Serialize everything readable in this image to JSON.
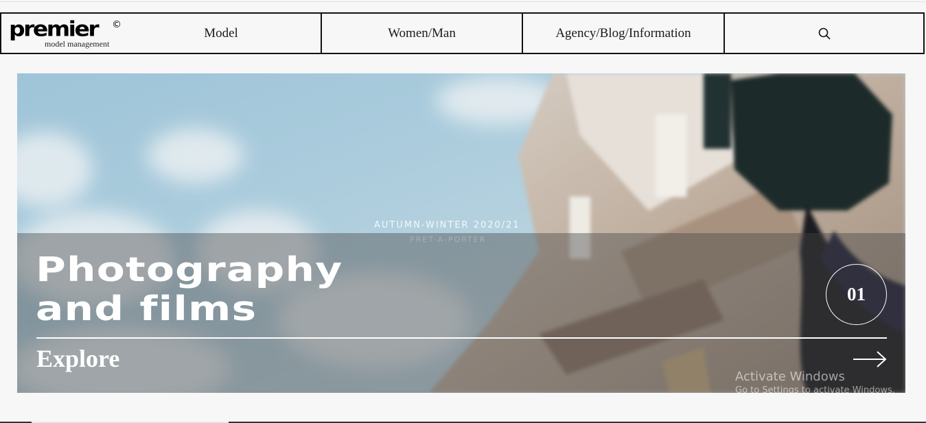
{
  "brand": {
    "logo_word": "premier",
    "logo_mark": "©",
    "logo_sub": "model management"
  },
  "nav": {
    "items": [
      {
        "label": "Model"
      },
      {
        "label": "Women/Man"
      },
      {
        "label": "Agency/Blog/Information"
      }
    ],
    "search_icon": "search-icon"
  },
  "hero": {
    "video_caption": "AUTUMN-WINTER 2020/21",
    "video_subcaption": "PRET-A-PORTER",
    "headline_line1": "Photography",
    "headline_line2": "and films",
    "cta_label": "Explore",
    "slide_number": "01",
    "arrow_icon": "arrow-right-icon"
  },
  "windows_watermark": {
    "title": "Activate Windows",
    "subtitle": "Go to Settings to activate Windows."
  },
  "colors": {
    "nav_border": "#111111",
    "page_bg": "#f7f7f7",
    "sky": "#a9cbdc",
    "overlay": "rgba(70,70,70,0.42)",
    "text_on_hero": "#ffffff"
  }
}
